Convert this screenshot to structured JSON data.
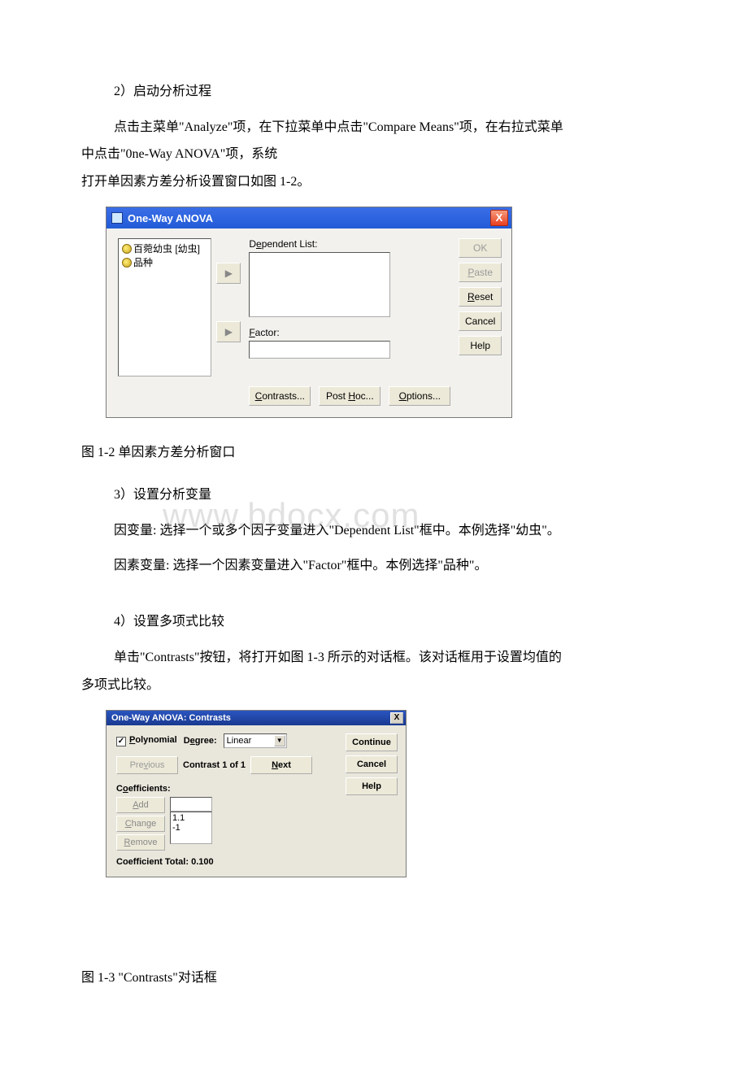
{
  "step2": {
    "heading": "2）启动分析过程",
    "desc_l1": "点击主菜单\"Analyze\"项，在下拉菜单中点击\"Compare Means\"项，在右拉式菜单",
    "desc_l2": "中点击\"0ne-Way ANOVA\"项，系统",
    "desc_l3": "打开单因素方差分析设置窗口如图 1-2。"
  },
  "dialog1": {
    "title": "One-Way ANOVA",
    "src1": "百菀幼虫 [幼虫]",
    "src2": "品种",
    "dep_label_pre": "D",
    "dep_label_u": "e",
    "dep_label_post": "pendent List:",
    "factor_pre": "",
    "factor_u": "F",
    "factor_post": "actor:",
    "btn_contrasts_u": "C",
    "btn_contrasts_rest": "ontrasts...",
    "btn_posthoc_pre": "Post ",
    "btn_posthoc_u": "H",
    "btn_posthoc_post": "oc...",
    "btn_options_u": "O",
    "btn_options_rest": "ptions...",
    "side_ok": "OK",
    "side_paste_u": "P",
    "side_paste_rest": "aste",
    "side_reset_u": "R",
    "side_reset_rest": "eset",
    "side_cancel": "Cancel",
    "side_help": "Help",
    "close_x": "X"
  },
  "caption1": "图 1-2 单因素方差分析窗口",
  "step3": {
    "heading": "3）设置分析变量",
    "line1": "因变量: 选择一个或多个因子变量进入\"Dependent List\"框中。本例选择\"幼虫\"。",
    "line2": "因素变量: 选择一个因素变量进入\"Factor\"框中。本例选择\"品种\"。"
  },
  "step4": {
    "heading": "4）设置多项式比较",
    "desc_l1": "单击\"Contrasts\"按钮，将打开如图 1-3 所示的对话框。该对话框用于设置均值的",
    "desc_l2": "多项式比较。"
  },
  "dialog2": {
    "title": "One-Way ANOVA: Contrasts",
    "poly_u": "P",
    "poly_rest": "olynomial",
    "degree_label_pre": "D",
    "degree_label_u": "e",
    "degree_label_post": "gree:",
    "degree_value": "Linear",
    "previous_pre": "Pre",
    "previous_u": "v",
    "previous_post": "ious",
    "contrast_n": "Contrast 1 of 1",
    "next_u": "N",
    "next_rest": "ext",
    "coef_label_pre": "C",
    "coef_label_u": "o",
    "coef_label_post": "efficients:",
    "add_u": "A",
    "add_rest": "dd",
    "change_u": "C",
    "change_rest": "hange",
    "remove_u": "R",
    "remove_rest": "emove",
    "coef_v1": "1.1",
    "coef_v2": "-1",
    "total": "Coefficient Total: 0.100",
    "btn_continue": "Continue",
    "btn_cancel": "Cancel",
    "btn_help": "Help",
    "close_x": "X"
  },
  "caption2": "图 1-3 \"Contrasts\"对话框",
  "watermark": "www.bdocx.com"
}
